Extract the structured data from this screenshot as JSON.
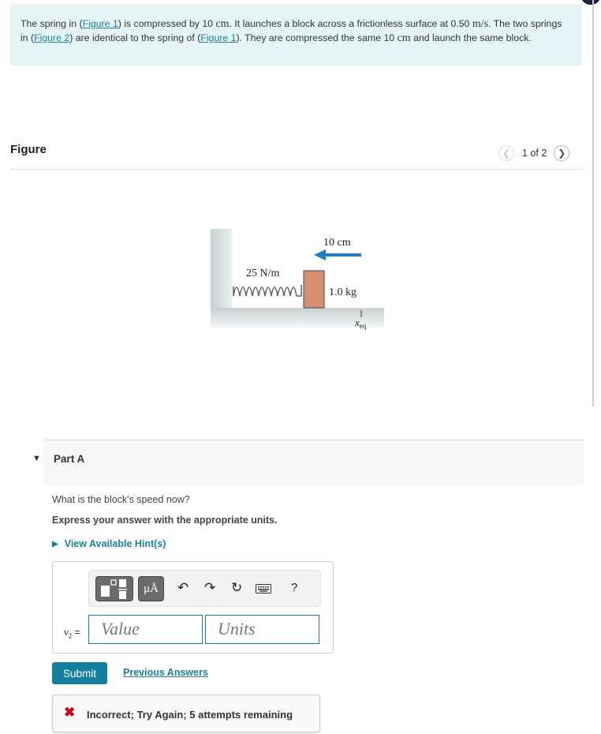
{
  "problem": {
    "t1": "The spring in (",
    "link1": "Figure 1",
    "t2": ") is compressed by 10 ",
    "u_cm": "cm",
    "t3": ". It launches a block across a frictionless surface at 0.50 ",
    "u_ms": "m/s",
    "t4": ". The two springs in (",
    "link2": "Figure 2",
    "t5": ") are identical to the spring of (",
    "link3": "Figure 1",
    "t6": "). They are compressed the same 10 ",
    "u_cm2": "cm",
    "t7": " and launch the same block."
  },
  "figure_panel": {
    "title": "Figure",
    "pager_text": "1 of 2",
    "prev_icon": "chevron-left",
    "next_icon": "chevron-right",
    "diagram": {
      "spring_constant": "25 N/m",
      "mass": "1.0 kg",
      "compression": "10 cm",
      "equilibrium_label": "x",
      "equilibrium_sub": "eq",
      "arrow_color": "#1e7fc4",
      "block_color": "#d99072"
    }
  },
  "part": {
    "label": "Part A",
    "question": "What is the block's speed now?",
    "instruction": "Express your answer with the appropriate units.",
    "hint_link": "View Available Hint(s)",
    "answer": {
      "variable": "v",
      "variable_sub": "2",
      "equals": " =",
      "value_placeholder": "Value",
      "units_placeholder": "Units",
      "toolbar": {
        "units_button": "μÅ",
        "help": "?"
      }
    },
    "submit_label": "Submit",
    "previous_answers_label": "Previous Answers",
    "feedback": "Incorrect; Try Again; 5 attempts remaining"
  }
}
